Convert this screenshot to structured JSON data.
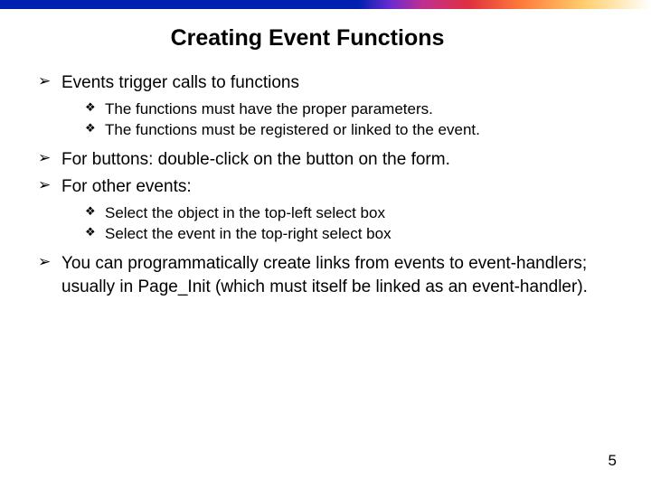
{
  "title": "Creating Event Functions",
  "bullets": {
    "b1": "Events trigger calls to functions",
    "b1_sub": {
      "s1": "The functions must have the proper parameters.",
      "s2": "The functions must be registered or linked to the event."
    },
    "b2": "For buttons: double-click on the button on the form.",
    "b3": "For other events:",
    "b3_sub": {
      "s1": "Select the object in the top-left select box",
      "s2": "Select the event in the top-right select box"
    },
    "b4": "You can programmatically create links from events to event-handlers; usually in Page_Init (which must itself be linked as an event-handler)."
  },
  "page_number": "5"
}
